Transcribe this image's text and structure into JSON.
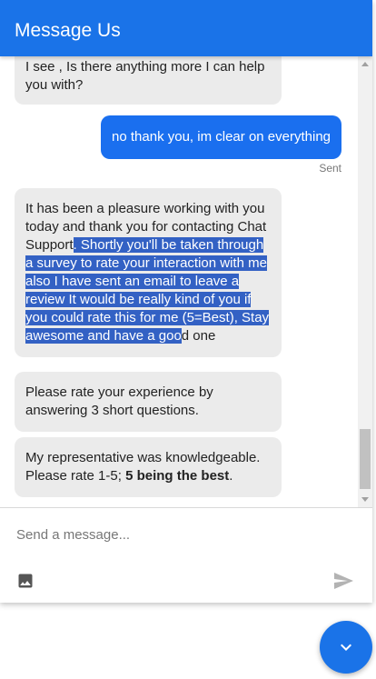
{
  "header": {
    "title": "Message Us"
  },
  "messages": [
    {
      "sender": "agent",
      "text": "I see , Is there anything  more I can help you with?"
    },
    {
      "sender": "user",
      "text": "no thank you, im clear on everything",
      "status": "Sent"
    },
    {
      "sender": "agent",
      "text_plain": "It has been a pleasure working with you today and thank you for contacting Chat Support",
      "text_selected": ". Shortly you'll be taken through a survey to rate your interaction with me also I have sent an email to leave a review It would be really kind of you if you could rate this for me (5=Best), Stay awesome and have a goo",
      "text_tail": "d one"
    },
    {
      "sender": "agent",
      "text": "Please rate your experience by answering 3 short questions."
    },
    {
      "sender": "agent",
      "text": "My representative was knowledgeable. Please rate 1-5; ",
      "text_bold": "5 being the best",
      "text_end": "."
    }
  ],
  "composer": {
    "placeholder": "Send a message..."
  },
  "icons": {
    "attach": "image-icon",
    "send": "send-icon",
    "minimize": "chevron-down-icon"
  },
  "colors": {
    "primary": "#1a73e8",
    "user_bubble": "#1a6fef",
    "agent_bubble": "#ebebeb",
    "selection": "#3361c4"
  }
}
